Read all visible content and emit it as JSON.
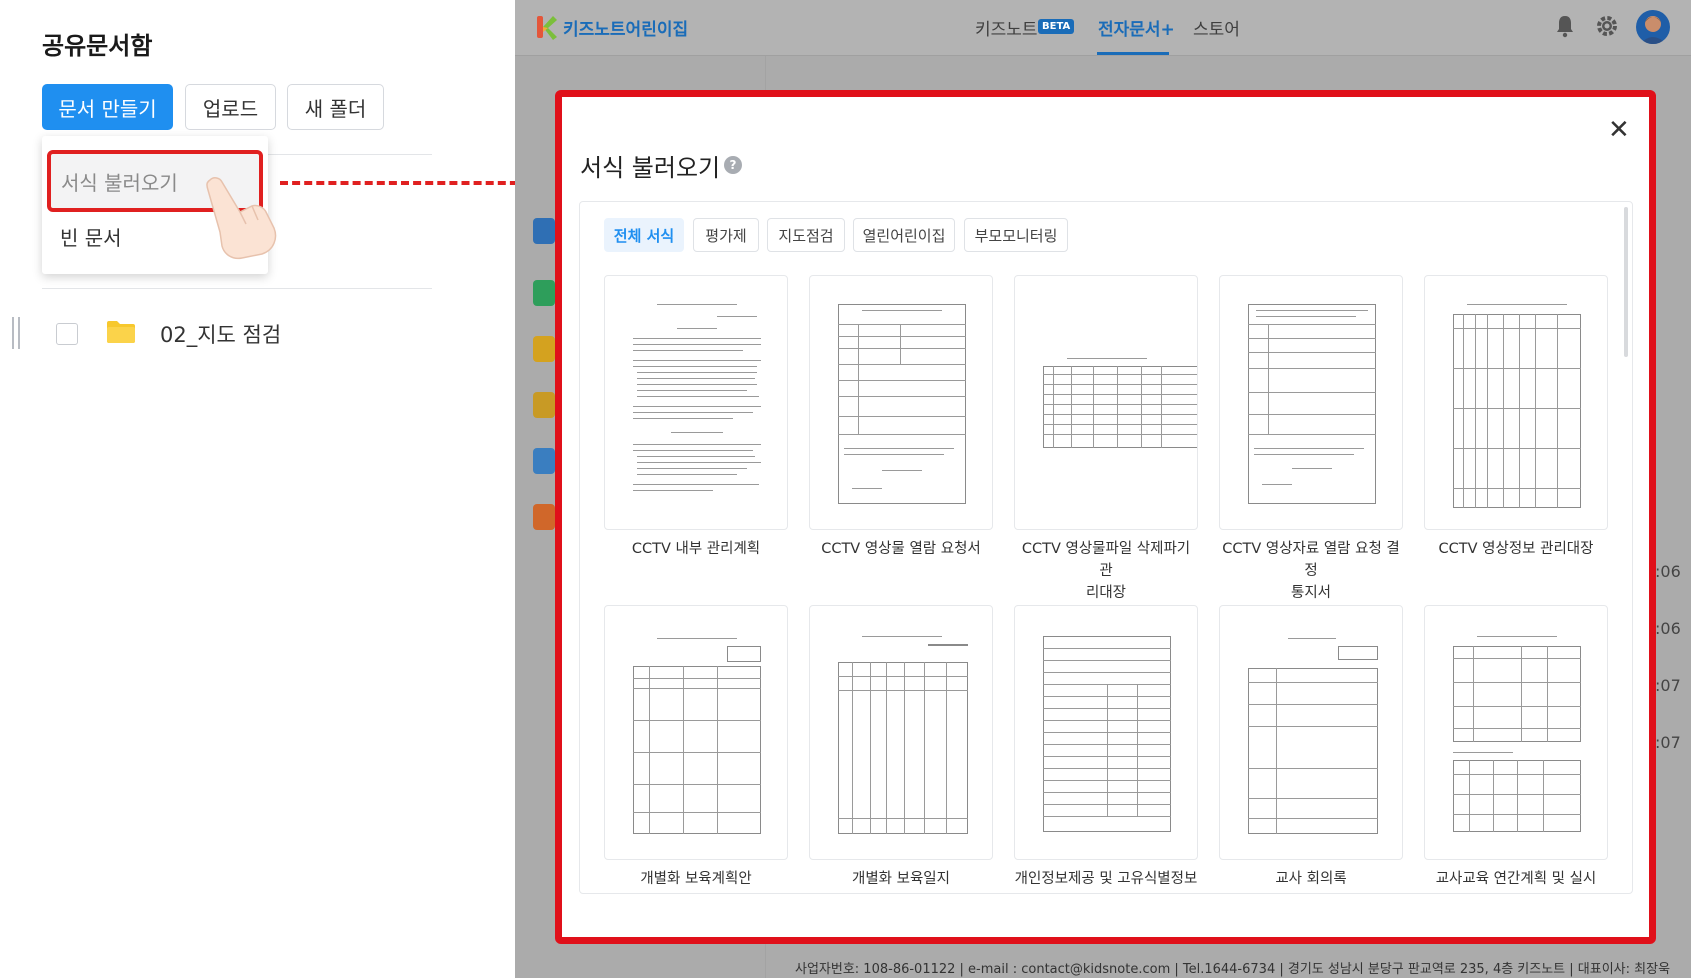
{
  "left": {
    "title": "공유문서함",
    "buttons": {
      "create": "문서 만들기",
      "upload": "업로드",
      "new_folder": "새 폴더"
    },
    "menu": {
      "load_template": "서식 불러오기",
      "blank_doc": "빈 문서"
    },
    "folder": {
      "name": "02_지도 점검"
    }
  },
  "app": {
    "brand": "키즈노트어린이집",
    "nav": {
      "kidsnote": "키즈노트",
      "beta": "BETA",
      "edoc": "전자문서+",
      "store": "스토어"
    },
    "bg_times": [
      ":06",
      ":06",
      ":07",
      ":07"
    ],
    "footer": "사업자번호: 108-86-01122  |  e-mail : contact@kidsnote.com  |  Tel.1644-6734  |  경기도 성남시 분당구 판교역로 235, 4층 키즈노트  |  대표이사: 최장욱"
  },
  "modal": {
    "title": "서식 불러오기",
    "help": "?",
    "close": "✕",
    "tabs": [
      "전체 서식",
      "평가제",
      "지도점검",
      "열린어린이집",
      "부모모니터링"
    ],
    "templates": [
      {
        "line1": "CCTV 내부 관리계획",
        "line2": ""
      },
      {
        "line1": "CCTV 영상물 열람 요청서",
        "line2": ""
      },
      {
        "line1": "CCTV 영상물파일 삭제파기 관",
        "line2": "리대장"
      },
      {
        "line1": "CCTV 영상자료 열람 요청 결정",
        "line2": "통지서"
      },
      {
        "line1": "CCTV 영상정보 관리대장",
        "line2": ""
      },
      {
        "line1": "개별화 보육계획안",
        "line2": ""
      },
      {
        "line1": "개별화 보육일지",
        "line2": ""
      },
      {
        "line1": "개인정보제공 및 고유식별정보",
        "line2": ""
      },
      {
        "line1": "교사 회의록",
        "line2": ""
      },
      {
        "line1": "교사교육 연간계획 및 실시",
        "line2": ""
      }
    ]
  },
  "colors": {
    "accent": "#1f8ff0",
    "highlight": "#e0101a",
    "brand": "#1a6cb8"
  }
}
